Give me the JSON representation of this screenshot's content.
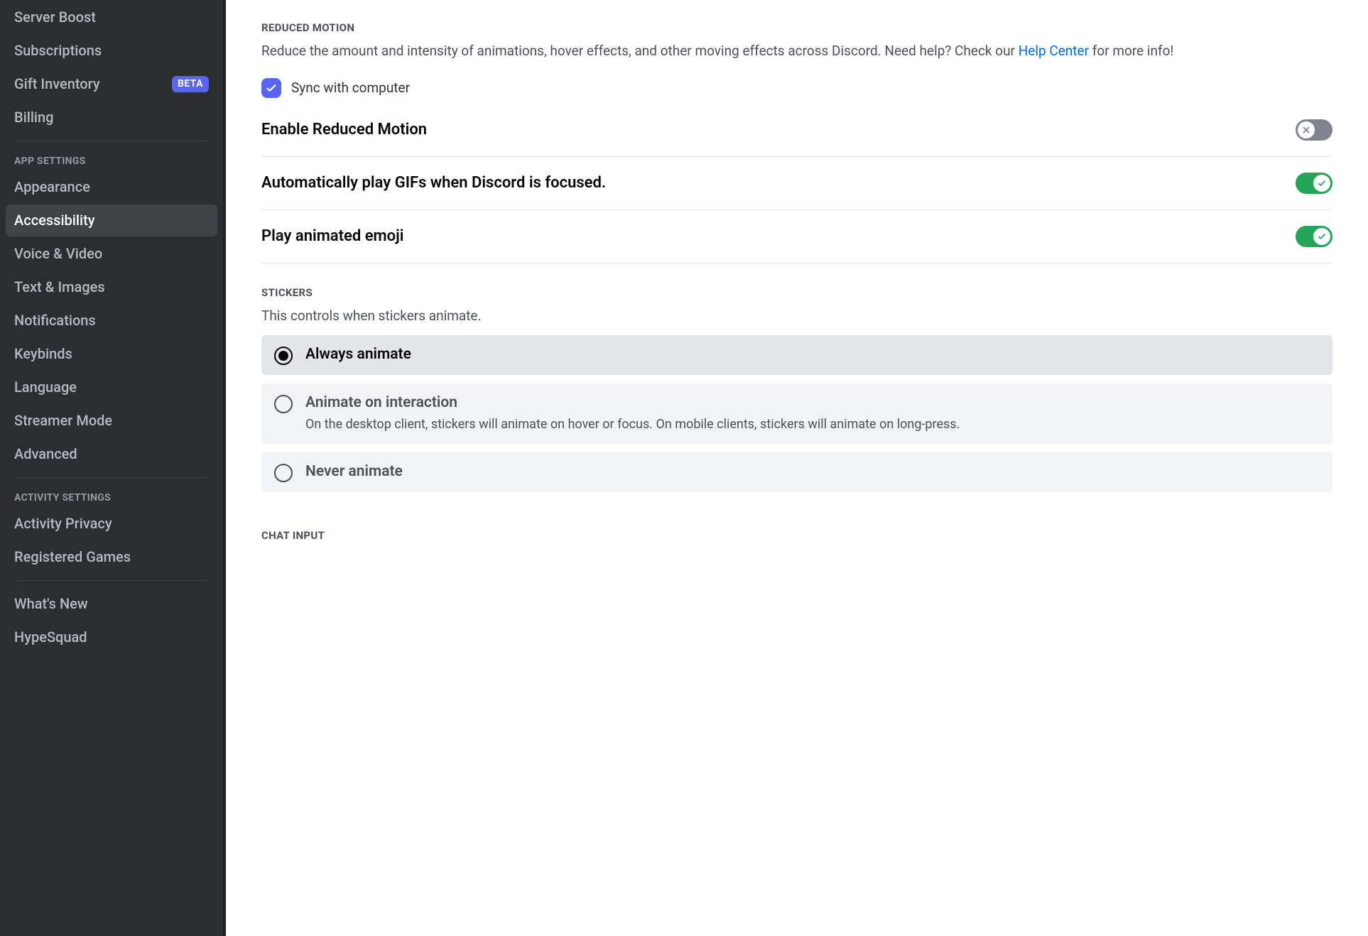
{
  "sidebar": {
    "items_top": [
      {
        "label": "Server Boost"
      },
      {
        "label": "Subscriptions"
      },
      {
        "label": "Gift Inventory",
        "badge": "BETA"
      },
      {
        "label": "Billing"
      }
    ],
    "header_app": "APP SETTINGS",
    "items_app": [
      {
        "label": "Appearance"
      },
      {
        "label": "Accessibility",
        "active": true
      },
      {
        "label": "Voice & Video"
      },
      {
        "label": "Text & Images"
      },
      {
        "label": "Notifications"
      },
      {
        "label": "Keybinds"
      },
      {
        "label": "Language"
      },
      {
        "label": "Streamer Mode"
      },
      {
        "label": "Advanced"
      }
    ],
    "header_activity": "ACTIVITY SETTINGS",
    "items_activity": [
      {
        "label": "Activity Privacy"
      },
      {
        "label": "Registered Games"
      }
    ],
    "items_bottom": [
      {
        "label": "What's New"
      },
      {
        "label": "HypeSquad"
      }
    ]
  },
  "reduced_motion": {
    "title": "REDUCED MOTION",
    "desc_a": "Reduce the amount and intensity of animations, hover effects, and other moving effects across Discord. Need help? Check our ",
    "link": "Help Center",
    "desc_b": " for more info!",
    "sync_label": "Sync with computer",
    "toggles": [
      {
        "label": "Enable Reduced Motion",
        "on": false
      },
      {
        "label": "Automatically play GIFs when Discord is focused.",
        "on": true
      },
      {
        "label": "Play animated emoji",
        "on": true
      }
    ]
  },
  "stickers": {
    "title": "STICKERS",
    "desc": "This controls when stickers animate.",
    "options": [
      {
        "title": "Always animate",
        "sub": "",
        "selected": true
      },
      {
        "title": "Animate on interaction",
        "sub": "On the desktop client, stickers will animate on hover or focus. On mobile clients, stickers will animate on long-press.",
        "selected": false
      },
      {
        "title": "Never animate",
        "sub": "",
        "selected": false
      }
    ]
  },
  "chat_input": {
    "title": "CHAT INPUT"
  }
}
